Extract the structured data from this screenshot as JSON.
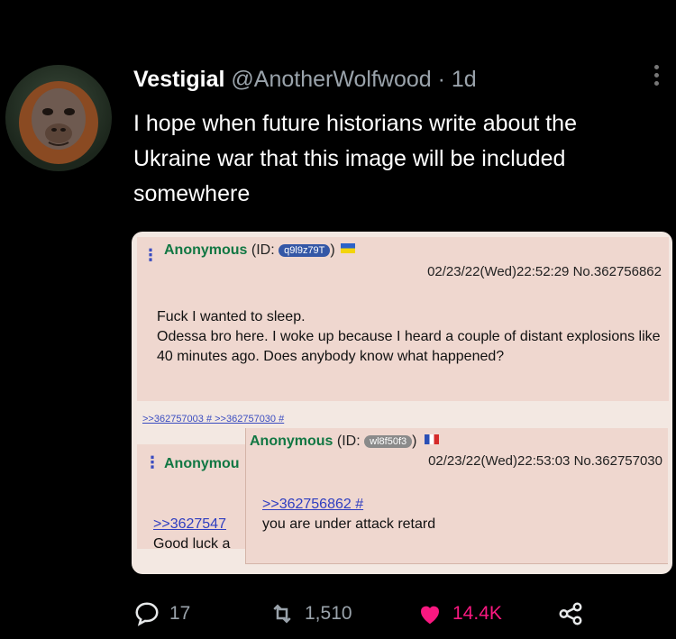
{
  "tweet": {
    "display_name": "Vestigial",
    "handle": "@AnotherWolfwood",
    "separator": "·",
    "time": "1d",
    "text": "I hope when future historians write about the Ukraine war that this image will be included somewhere"
  },
  "embedded_image": {
    "post1": {
      "name": "Anonymous",
      "id_prefix": "(ID:",
      "id": "q9l9z79T",
      "id_suffix": ")",
      "date": "02/23/22(Wed)22:52:29 No.362756862",
      "body": "Fuck I wanted to sleep.\nOdessa bro here. I woke up because I heard a couple of distant explosions like 40 minutes ago. Does anybody know what happened?",
      "backlinks": ">>362757003 # >>362757030 #"
    },
    "post2": {
      "name": "Anonymous",
      "id_prefix": "(ID:",
      "id": "wl8f50f3",
      "id_suffix": ")",
      "date": "02/23/22(Wed)22:53:03 No.362757030",
      "quote": ">>362756862 #",
      "body": "you are under attack retard"
    },
    "post3": {
      "name": "Anonymou",
      "quote": ">>3627547",
      "body": "Good luck a"
    }
  },
  "actions": {
    "replies": "17",
    "retweets": "1,510",
    "likes": "14.4K"
  },
  "colors": {
    "like": "#f91880",
    "muted": "#9aa3ab",
    "post_bg": "#efd7cf",
    "anon_green": "#117743",
    "link_blue": "#3a4cc0"
  }
}
